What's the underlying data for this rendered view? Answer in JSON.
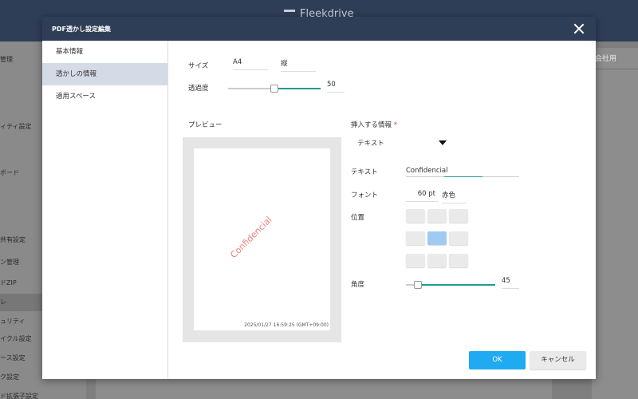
{
  "app": {
    "logo_text": "Fleekdrive",
    "right_label": "会社用"
  },
  "bg_sidebar": {
    "items": [
      "管理",
      "ィティ設定",
      "ボード",
      "共有設定",
      "ン管理",
      "ドZIP",
      "レ",
      "ュリティ",
      "イクル設定",
      "ース設定",
      "ク設定",
      "ド拡張子設定"
    ]
  },
  "modal": {
    "title": "PDF透かし設定編集",
    "nav": [
      "基本情報",
      "透かしの情報",
      "適用スペース"
    ],
    "size_label": "サイズ",
    "size_value": "A4",
    "orientation_value": "縦",
    "opacity_label": "透過度",
    "opacity_value": "50",
    "preview_label": "プレビュー",
    "watermark_text": "Confidencial",
    "preview_timestamp": "2025/01/27 16:59:25 (GMT+09:00)",
    "insert_label": "挿入する情報",
    "required_mark": "*",
    "insert_value": "テキスト",
    "text_label": "テキスト",
    "text_value": "Confidencial",
    "font_label": "フォント",
    "font_size": "60",
    "font_unit": "pt",
    "font_color": "赤色",
    "position_label": "位置",
    "angle_label": "角度",
    "angle_value": "45",
    "ok_label": "OK",
    "cancel_label": "キャンセル"
  },
  "colors": {
    "header": "#2f3e57",
    "accent": "#1faaf2",
    "slider": "#1e9c8f",
    "watermark": "#f08080",
    "selected_position": "#9fcbf2"
  },
  "sliders": {
    "opacity_percent": 50,
    "angle_degrees": 45
  }
}
